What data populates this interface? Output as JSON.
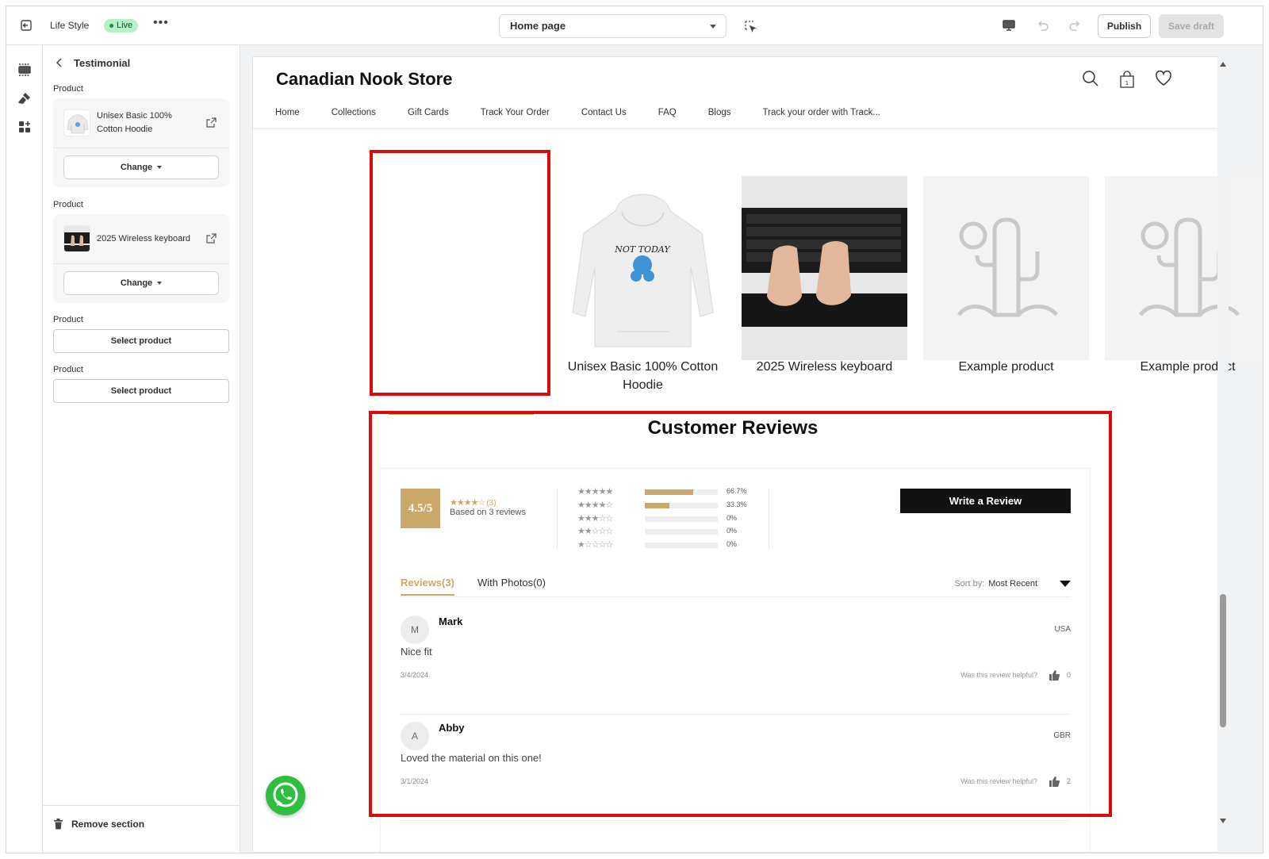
{
  "topbar": {
    "store_name": "Life Style",
    "status": "Live",
    "more": "•••",
    "page_selector": "Home page",
    "publish_label": "Publish",
    "save_label": "Save draft"
  },
  "panel": {
    "title": "Testimonial",
    "slots": [
      {
        "label": "Product",
        "product_name": "Unisex Basic 100% Cotton Hoodie",
        "change_label": "Change"
      },
      {
        "label": "Product",
        "product_name": "2025 Wireless keyboard",
        "change_label": "Change"
      },
      {
        "label": "Product",
        "select_label": "Select product"
      },
      {
        "label": "Product",
        "select_label": "Select product"
      }
    ],
    "remove_label": "Remove section"
  },
  "store": {
    "name": "Canadian Nook Store",
    "nav": [
      "Home",
      "Collections",
      "Gift Cards",
      "Track Your Order",
      "Contact Us",
      "FAQ",
      "Blogs",
      "Track your order with Track..."
    ],
    "cart_count": "1"
  },
  "products": [
    {
      "name": "Unisex Basic 100% Cotton Hoodie",
      "hoodie_text": "NOT TODAY"
    },
    {
      "name": "2025 Wireless keyboard"
    },
    {
      "name": "Example product"
    },
    {
      "name": "Example product"
    }
  ],
  "reviews": {
    "title": "Customer Reviews",
    "score": "4.5/5",
    "stars": "★★★★☆",
    "count": "(3)",
    "based_on": "Based on 3 reviews",
    "distribution": [
      {
        "stars": "★★★★★",
        "fraction": 0.667,
        "percent": "66.7%"
      },
      {
        "stars": "★★★★☆",
        "fraction": 0.333,
        "percent": "33.3%"
      },
      {
        "stars": "★★★☆☆",
        "fraction": 0,
        "percent": "0%"
      },
      {
        "stars": "★★☆☆☆",
        "fraction": 0,
        "percent": "0%"
      },
      {
        "stars": "★☆☆☆☆",
        "fraction": 0,
        "percent": "0%"
      }
    ],
    "write_label": "Write a Review",
    "tab_all": "Reviews(3)",
    "tab_photos": "With Photos(0)",
    "sort_label": "Sort by:",
    "sort_value": "Most Recent",
    "helpful_label": "Was this review helpful?",
    "items": [
      {
        "initial": "M",
        "name": "Mark",
        "country": "USA",
        "body": "Nice fit",
        "date": "3/4/2024",
        "votes": "0"
      },
      {
        "initial": "A",
        "name": "Abby",
        "country": "GBR",
        "body": "Loved the material on this one!",
        "date": "3/1/2024",
        "votes": "2"
      }
    ]
  },
  "colors": {
    "accent": "#c9a86a",
    "highlight": "#d90b0b",
    "live_badge": "#b6f0c5",
    "whatsapp": "#2fbe3f"
  }
}
